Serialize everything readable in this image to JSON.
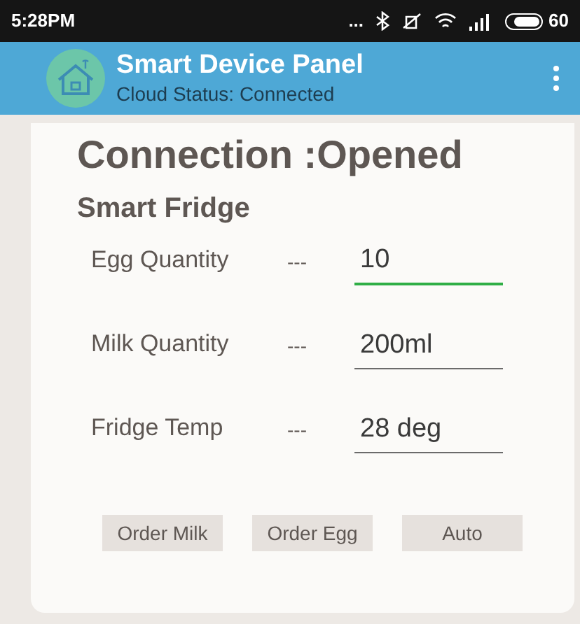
{
  "status_bar": {
    "time": "5:28PM",
    "more": "...",
    "battery": "60"
  },
  "app_bar": {
    "title": "Smart Device Panel",
    "subtitle": "Cloud Status: Connected"
  },
  "connection": "Connection :Opened",
  "device": "Smart Fridge",
  "fields": [
    {
      "label": "Egg Quantity",
      "separator": "---",
      "value": "10",
      "focused": true
    },
    {
      "label": "Milk Quantity",
      "separator": "---",
      "value": "200ml",
      "focused": false
    },
    {
      "label": "Fridge Temp",
      "separator": "---",
      "value": "28 deg",
      "focused": false
    }
  ],
  "buttons": [
    "Order Milk",
    "Order Egg",
    "Auto"
  ]
}
